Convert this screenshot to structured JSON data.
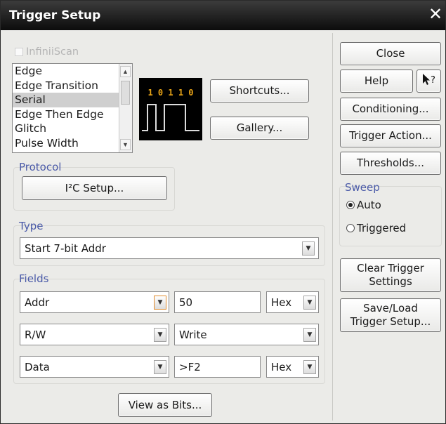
{
  "window": {
    "title": "Trigger Setup"
  },
  "infiniiscan": {
    "label": "InfiniiScan",
    "checked": false,
    "enabled": false
  },
  "trigger_type_list": {
    "items": [
      "Edge",
      "Edge Transition",
      "Serial",
      "Edge Then Edge",
      "Glitch",
      "Pulse Width"
    ],
    "selected": "Serial"
  },
  "preview": {
    "bits": "1 0 1 1 0"
  },
  "buttons": {
    "shortcuts": "Shortcuts...",
    "gallery": "Gallery...",
    "close": "Close",
    "help": "Help",
    "conditioning": "Conditioning...",
    "trigger_action": "Trigger Action...",
    "thresholds": "Thresholds...",
    "clear_trigger_line1": "Clear Trigger",
    "clear_trigger_line2": "Settings",
    "save_load_line1": "Save/Load",
    "save_load_line2": "Trigger Setup...",
    "view_as_bits": "View as Bits..."
  },
  "protocol": {
    "label": "Protocol",
    "setup_button": "I²C Setup..."
  },
  "type": {
    "label": "Type",
    "value": "Start 7-bit Addr"
  },
  "fields": {
    "label": "Fields",
    "rows": [
      {
        "name": "Addr",
        "value": "50",
        "format": "Hex"
      },
      {
        "name": "R/W",
        "value": "Write"
      },
      {
        "name": "Data",
        "value": ">F2",
        "format": "Hex"
      }
    ]
  },
  "sweep": {
    "label": "Sweep",
    "options": [
      "Auto",
      "Triggered"
    ],
    "selected": "Auto"
  }
}
